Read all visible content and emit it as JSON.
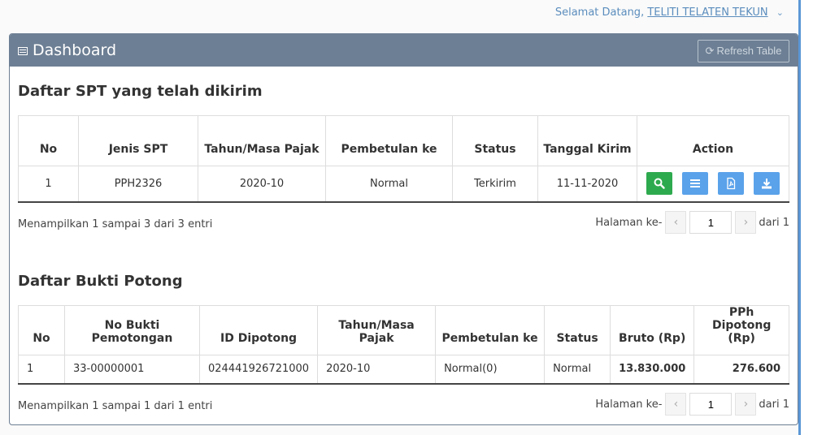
{
  "header": {
    "greeting": "Selamat Datang, ",
    "user": "TELITI TELATEN TEKUN"
  },
  "panel": {
    "title": "Dashboard",
    "refresh_label": "Refresh Table"
  },
  "spt": {
    "title": "Daftar SPT yang telah dikirim",
    "columns": [
      "No",
      "Jenis SPT",
      "Tahun/Masa Pajak",
      "Pembetulan ke",
      "Status",
      "Tanggal Kirim",
      "Action"
    ],
    "rows": [
      {
        "no": "1",
        "jenis": "PPH2326",
        "masa": "2020-10",
        "pembetulan": "Normal",
        "status": "Terkirim",
        "tanggal": "11-11-2020"
      }
    ],
    "info": "Menampilkan 1 sampai 3 dari 3 entri",
    "pager": {
      "label": "Halaman ke-",
      "page": "1",
      "total": "dari 1"
    }
  },
  "bukti": {
    "title": "Daftar Bukti Potong",
    "columns": [
      "No",
      "No Bukti Pemotongan",
      "ID Dipotong",
      "Tahun/Masa Pajak",
      "Pembetulan ke",
      "Status",
      "Bruto (Rp)",
      "PPh Dipotong (Rp)"
    ],
    "rows": [
      {
        "no": "1",
        "nomor": "33-00000001",
        "id": "024441926721000",
        "masa": "2020-10",
        "pembetulan": "Normal(0)",
        "status": "Normal",
        "bruto": "13.830.000",
        "pph": "276.600"
      }
    ],
    "info": "Menampilkan 1 sampai 1 dari 1 entri",
    "pager": {
      "label": "Halaman ke-",
      "page": "1",
      "total": "dari 1"
    }
  },
  "icons": [
    "search-icon",
    "list-icon",
    "pdf-icon",
    "download-icon",
    "refresh-icon",
    "chevron-down-icon",
    "table-icon"
  ]
}
